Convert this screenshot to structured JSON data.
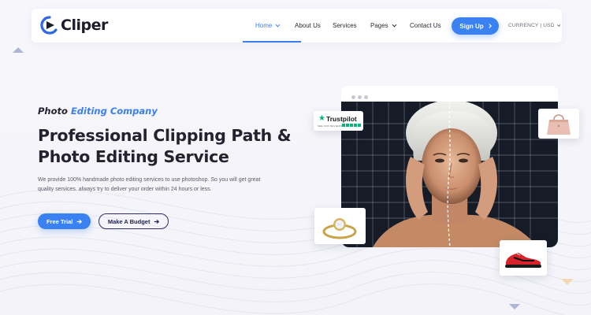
{
  "brand": {
    "name": "Cliper",
    "logo_color": "#2f68e6"
  },
  "nav": {
    "items": [
      {
        "label": "Home",
        "has_dropdown": true,
        "active": true
      },
      {
        "label": "About Us",
        "has_dropdown": false,
        "active": false
      },
      {
        "label": "Services",
        "has_dropdown": false,
        "active": false
      },
      {
        "label": "Pages",
        "has_dropdown": true,
        "active": false
      },
      {
        "label": "Contact Us",
        "has_dropdown": false,
        "active": false
      }
    ],
    "signup_label": "Sign Up",
    "currency_label": "CURRENCY | USD"
  },
  "hero": {
    "tagline_prefix": "Photo",
    "tagline_accent": "Editing Company",
    "headline_line1": "Professional Clipping Path &",
    "headline_line2": "Photo Editing Service",
    "description": "We provide 100% handmade photo editing services to use photoshop. So you will get great quality services. always try to deliver your order within 24 hours or less.",
    "primary_button": "Free Trial",
    "secondary_button": "Make A Budget"
  },
  "trustpilot": {
    "name": "Trustpilot",
    "subtitle": "SEE OUR REVIEWS"
  },
  "icons": {
    "logo": "play-logo-icon",
    "chevron": "chevron-down-icon",
    "arrow": "arrow-right-icon",
    "trust_star": "star-icon"
  },
  "colors": {
    "accent": "#3a82f2",
    "dark": "#23232f",
    "photo_bg": "#151b27",
    "trustpilot_green": "#00b67a"
  }
}
